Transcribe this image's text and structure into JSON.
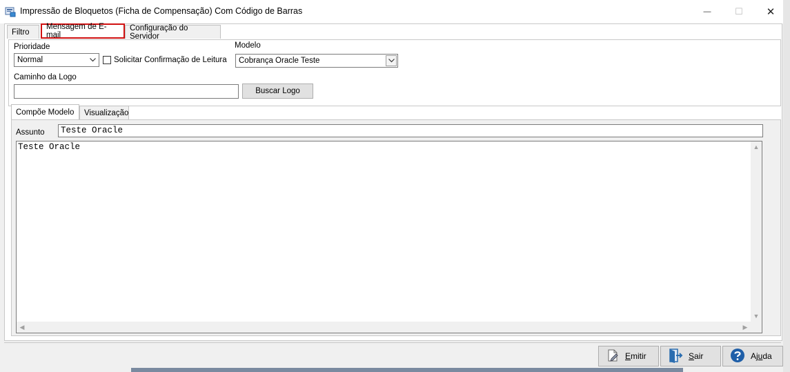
{
  "window": {
    "title": "Impressão  de Bloquetos (Ficha de Compensação) Com Código de Barras",
    "minimize_glyph": "—",
    "maximize_glyph": "☐",
    "close_glyph": "✕"
  },
  "outer_tabs": [
    {
      "label": "Filtro",
      "active": false
    },
    {
      "label": "Mensagem de E-mail",
      "active": true
    },
    {
      "label": "Configuração do Servidor",
      "active": false
    }
  ],
  "form": {
    "prioridade_label": "Prioridade",
    "prioridade_value": "Normal",
    "confirmacao_label": "Solicitar Confirmação de Leitura",
    "modelo_label": "Modelo",
    "modelo_value": "Cobrança Oracle Teste",
    "caminho_label": "Caminho da Logo",
    "caminho_value": "",
    "buscar_label": "Buscar Logo"
  },
  "inner_tabs": [
    {
      "label": "Compõe Modelo",
      "active": true
    },
    {
      "label": "Visualização",
      "active": false
    }
  ],
  "compose": {
    "assunto_label": "Assunto",
    "assunto_value": "Teste Oracle",
    "body_text": "Teste Oracle"
  },
  "bottom_buttons": {
    "emitir": {
      "prefix": "",
      "accel": "E",
      "rest": "mitir"
    },
    "sair": {
      "prefix": "",
      "accel": "S",
      "rest": "air"
    },
    "ajuda": {
      "prefix": "Aj",
      "accel": "u",
      "rest": "da"
    }
  },
  "colors": {
    "highlight": "#d01010",
    "help_icon": "#1f5fa8",
    "exit_icon": "#2a6db0"
  },
  "icons": {
    "app": "app-window-icon",
    "emitir": "document-edit-icon",
    "sair": "exit-door-icon",
    "ajuda": "help-icon"
  }
}
